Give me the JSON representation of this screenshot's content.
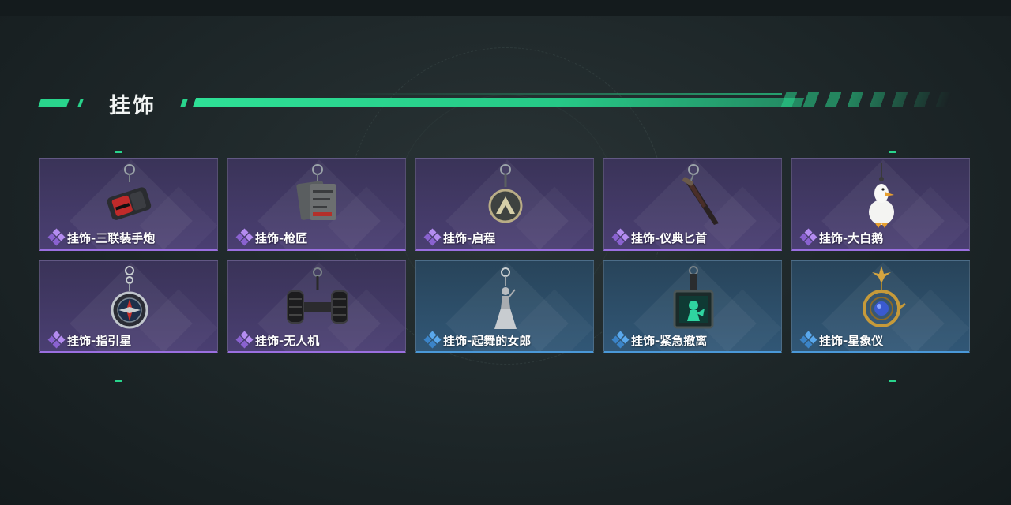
{
  "section": {
    "title": "挂饰"
  },
  "colors": {
    "accent": "#29d48c",
    "purple_rarity": "#9a6fe0",
    "blue_rarity": "#4a98d8"
  },
  "items": [
    {
      "name": "挂饰-三联装手炮",
      "rarity": "purple",
      "icon": "triple-hand-cannon-charm"
    },
    {
      "name": "挂饰-枪匠",
      "rarity": "purple",
      "icon": "gunsmith-tag-charm"
    },
    {
      "name": "挂饰-启程",
      "rarity": "purple",
      "icon": "departure-medallion-charm"
    },
    {
      "name": "挂饰-仪典匕首",
      "rarity": "purple",
      "icon": "ceremonial-dagger-charm"
    },
    {
      "name": "挂饰-大白鹅",
      "rarity": "purple",
      "icon": "white-goose-charm"
    },
    {
      "name": "挂饰-指引星",
      "rarity": "purple",
      "icon": "compass-star-charm"
    },
    {
      "name": "挂饰-无人机",
      "rarity": "purple",
      "icon": "drone-charm"
    },
    {
      "name": "挂饰-起舞的女郎",
      "rarity": "blue",
      "icon": "dancing-lady-charm"
    },
    {
      "name": "挂饰-紧急撤离",
      "rarity": "blue",
      "icon": "emergency-evac-charm"
    },
    {
      "name": "挂饰-星象仪",
      "rarity": "blue",
      "icon": "astrolabe-charm"
    }
  ]
}
